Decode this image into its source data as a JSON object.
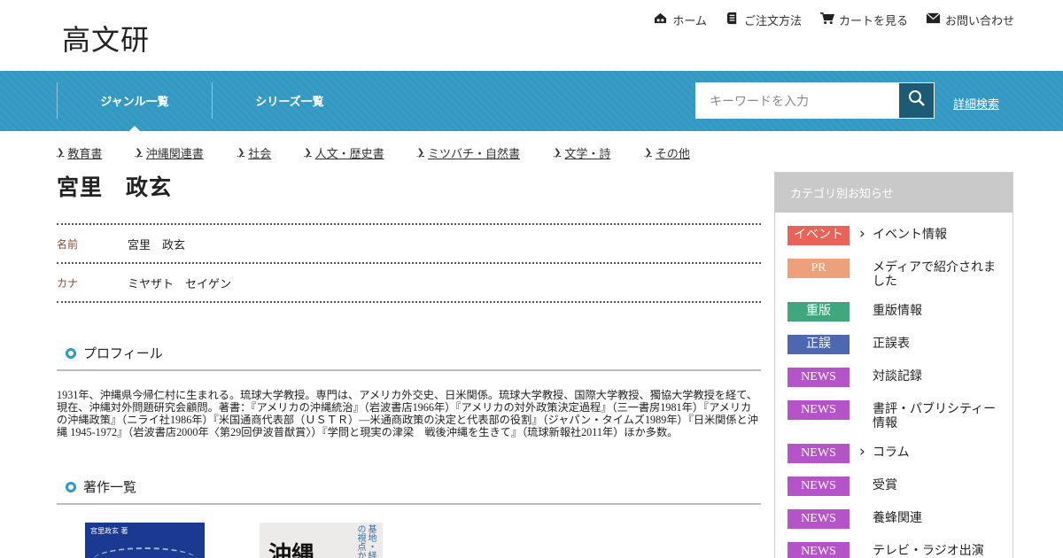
{
  "logo": "高文研",
  "utility_nav": [
    {
      "label": "ホーム",
      "icon": "home-icon"
    },
    {
      "label": "ご注文方法",
      "icon": "order-doc-icon"
    },
    {
      "label": "カートを見る",
      "icon": "cart-icon"
    },
    {
      "label": "お問い合わせ",
      "icon": "mail-icon"
    }
  ],
  "nav": {
    "tabs": [
      "ジャンル一覧",
      "シリーズ一覧"
    ],
    "search_placeholder": "キーワードを入力",
    "advanced_search": "詳細検索"
  },
  "genres": [
    "教育書",
    "沖縄関連書",
    "社会",
    "人文・歴史書",
    "ミツバチ・自然書",
    "文学・詩",
    "その他"
  ],
  "author": {
    "title": "宮里　政玄",
    "fields": [
      {
        "key": "名前",
        "value": "宮里　政玄"
      },
      {
        "key": "カナ",
        "value": "ミヤザト　セイゲン"
      }
    ],
    "profile_heading": "プロフィール",
    "profile_text": "1931年、沖縄県今帰仁村に生まれる。琉球大学教授。専門は、アメリカ外交史、日米関係。琉球大学教授、国際大学教授、獨協大学教授を経て、現在、沖縄対外問題研究会顧問。著書：『アメリカの沖縄統治』（岩波書店1966年）『アメリカの対外政策決定過程』（三一書房1981年）『アメリカの沖縄政策』（ニライ社1986年）『米国通商代表部（ＵＳＴＲ）―米通商政策の決定と代表部の役割』（ジャパン・タイムズ1989年）『日米関係と沖縄 1945-1972』（岩波書店2000年〈第29回伊波普猷賞〉）『学問と現実の津梁　戦後沖縄を生きて』（琉球新報社2011年）ほか多数。",
    "works_heading": "著作一覧",
    "cover1_text": "宮里政玄 著",
    "cover2_big": "沖縄",
    "cover2_vertical": "基地・経済の視点から"
  },
  "sidebar": {
    "heading": "カテゴリ別お知らせ",
    "items": [
      {
        "badge": "イベント",
        "color": "#e8645a",
        "label": "イベント情報",
        "chevron": true
      },
      {
        "badge": "PR",
        "color": "#eda07a",
        "label": "メディアで紹介されました",
        "chevron": false
      },
      {
        "badge": "重版",
        "color": "#3fa67e",
        "label": "重版情報",
        "chevron": false
      },
      {
        "badge": "正誤",
        "color": "#4d68b0",
        "label": "正誤表",
        "chevron": false
      },
      {
        "badge": "NEWS",
        "color": "#b553c8",
        "label": "対談記録",
        "chevron": false
      },
      {
        "badge": "NEWS",
        "color": "#b553c8",
        "label": "書評・パブリシティー情報",
        "chevron": false
      },
      {
        "badge": "NEWS",
        "color": "#b553c8",
        "label": "コラム",
        "chevron": true
      },
      {
        "badge": "NEWS",
        "color": "#b553c8",
        "label": "受賞",
        "chevron": false
      },
      {
        "badge": "NEWS",
        "color": "#b553c8",
        "label": "養蜂関連",
        "chevron": false
      },
      {
        "badge": "NEWS",
        "color": "#b553c8",
        "label": "テレビ・ラジオ出演",
        "chevron": false
      }
    ]
  }
}
